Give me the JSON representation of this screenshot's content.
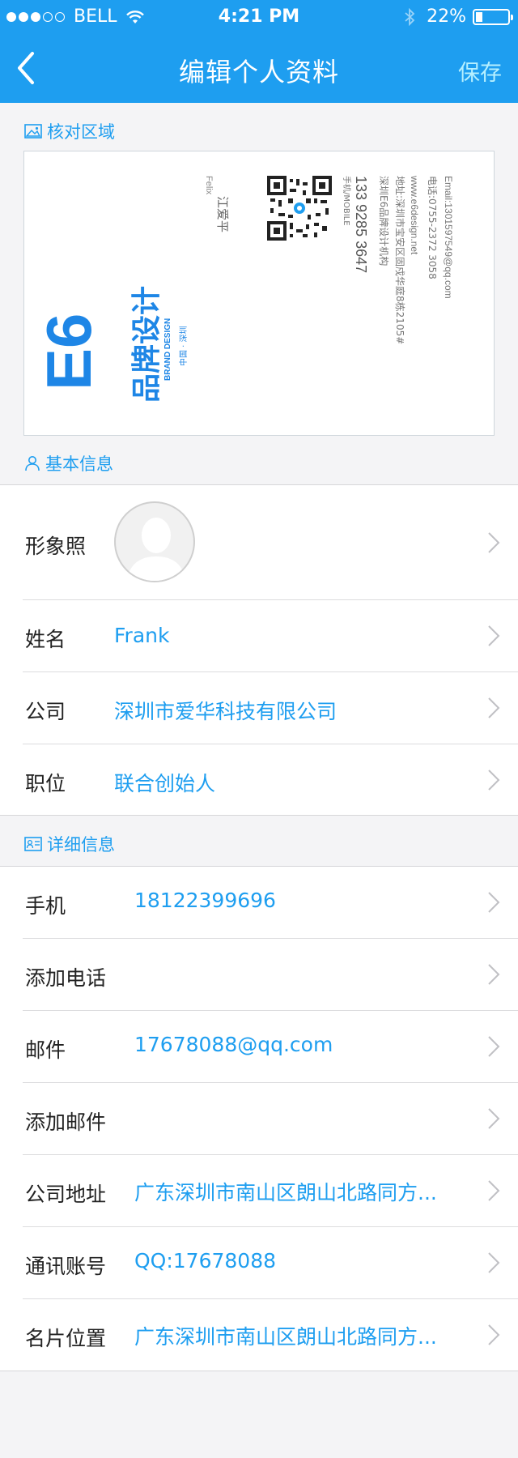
{
  "status_bar": {
    "carrier": "BELL",
    "time": "4:21 PM",
    "battery": "22%",
    "battery_level": 0.22
  },
  "nav": {
    "title": "编辑个人资料",
    "save_label": "保存"
  },
  "sections": {
    "verify": "核对区域",
    "basic": "基本信息",
    "detail": "详细信息"
  },
  "business_card": {
    "logo_text": "E6",
    "brand_cn": "品牌设计",
    "brand_en": "BRAND DESIGN",
    "location": "中国 · 深圳",
    "name_en": "Felix",
    "name_cn": "江爱平",
    "mobile_label": "手机/MOBILE",
    "mobile": "133 9285 3647",
    "org": "深圳E6品牌设计机构",
    "address": "地址:深圳市宝安区固戍华庭8栋2105#",
    "website": "www.e6design.net",
    "phone": "电话:0755-2372 3058",
    "email": "Email:1301597549@qq.com"
  },
  "basic": {
    "photo_label": "形象照",
    "name_label": "姓名",
    "name_value": "Frank",
    "company_label": "公司",
    "company_value": "深圳市爱华科技有限公司",
    "title_label": "职位",
    "title_value": "联合创始人"
  },
  "detail": {
    "rows": [
      {
        "label": "手机",
        "value": "18122399696"
      },
      {
        "label": "添加电话",
        "value": ""
      },
      {
        "label": "邮件",
        "value": "17678088@qq.com"
      },
      {
        "label": "添加邮件",
        "value": ""
      },
      {
        "label": "公司地址",
        "value": "广东深圳市南山区朗山北路同方..."
      },
      {
        "label": "通讯账号",
        "value": "QQ:17678088"
      },
      {
        "label": "名片位置",
        "value": "广东深圳市南山区朗山北路同方..."
      }
    ]
  },
  "colors": {
    "accent": "#1e9ef0",
    "save_text": "#b6f0ff",
    "background": "#f4f4f6"
  }
}
